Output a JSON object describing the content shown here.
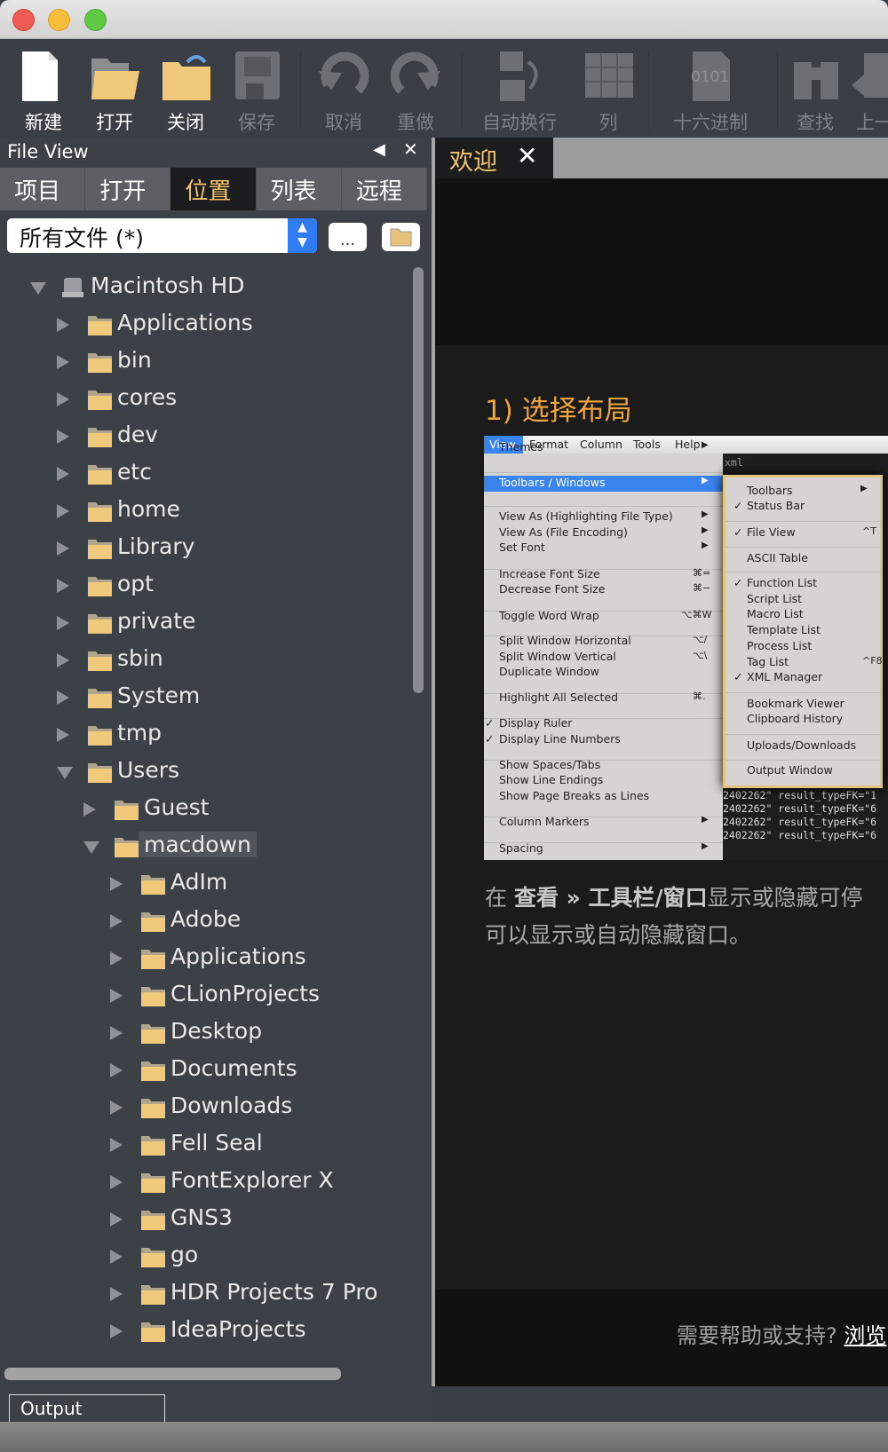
{
  "toolbar": {
    "items": [
      {
        "label": "新建",
        "icon": "new-file-icon",
        "enabled": true
      },
      {
        "label": "打开",
        "icon": "open-folder-icon",
        "enabled": true
      },
      {
        "label": "关闭",
        "icon": "close-folder-icon",
        "enabled": true
      },
      {
        "label": "保存",
        "icon": "save-icon",
        "enabled": false
      },
      {
        "label": "取消",
        "icon": "undo-icon",
        "enabled": false
      },
      {
        "label": "重做",
        "icon": "redo-icon",
        "enabled": false
      },
      {
        "label": "自动换行",
        "icon": "word-wrap-icon",
        "enabled": false
      },
      {
        "label": "列",
        "icon": "column-icon",
        "enabled": false
      },
      {
        "label": "十六进制",
        "icon": "hex-icon",
        "enabled": false,
        "glyph": "0101"
      },
      {
        "label": "查找",
        "icon": "find-binoculars-icon",
        "enabled": false
      },
      {
        "label": "上一",
        "icon": "previous-icon",
        "enabled": false
      }
    ]
  },
  "fileview": {
    "title": "File View",
    "tabs": [
      {
        "label": "项目"
      },
      {
        "label": "打开"
      },
      {
        "label": "位置",
        "active": true
      },
      {
        "label": "列表"
      },
      {
        "label": "远程"
      }
    ],
    "filter": "所有文件 (*)",
    "browse_label": "...",
    "tree": [
      {
        "name": "Macintosh HD",
        "depth": 0,
        "expanded": true,
        "icon": "disk"
      },
      {
        "name": "Applications",
        "depth": 1
      },
      {
        "name": "bin",
        "depth": 1
      },
      {
        "name": "cores",
        "depth": 1
      },
      {
        "name": "dev",
        "depth": 1
      },
      {
        "name": "etc",
        "depth": 1
      },
      {
        "name": "home",
        "depth": 1
      },
      {
        "name": "Library",
        "depth": 1
      },
      {
        "name": "opt",
        "depth": 1
      },
      {
        "name": "private",
        "depth": 1
      },
      {
        "name": "sbin",
        "depth": 1
      },
      {
        "name": "System",
        "depth": 1
      },
      {
        "name": "tmp",
        "depth": 1
      },
      {
        "name": "Users",
        "depth": 1,
        "expanded": true
      },
      {
        "name": "Guest",
        "depth": 2
      },
      {
        "name": "macdown",
        "depth": 2,
        "expanded": true,
        "selected": true
      },
      {
        "name": "AdIm",
        "depth": 3
      },
      {
        "name": "Adobe",
        "depth": 3
      },
      {
        "name": "Applications",
        "depth": 3
      },
      {
        "name": "CLionProjects",
        "depth": 3
      },
      {
        "name": "Desktop",
        "depth": 3
      },
      {
        "name": "Documents",
        "depth": 3
      },
      {
        "name": "Downloads",
        "depth": 3
      },
      {
        "name": "Fell Seal",
        "depth": 3
      },
      {
        "name": "FontExplorer X",
        "depth": 3
      },
      {
        "name": "GNS3",
        "depth": 3
      },
      {
        "name": "go",
        "depth": 3
      },
      {
        "name": "HDR Projects 7 Pro",
        "depth": 3
      },
      {
        "name": "IdeaProjects",
        "depth": 3
      }
    ]
  },
  "output_tab": "Output Window",
  "editor": {
    "tab": "欢迎",
    "tab_close": "✕",
    "heading": "1) 选择布局",
    "desc_line1_a": "在 ",
    "desc_line1_b": "查看 » 工具栏/窗口",
    "desc_line1_c": "显示或隐藏可停",
    "desc_line2": "可以显示或自动隐藏窗口。",
    "help_text": "需要帮助或支持?",
    "help_link": "浏览"
  },
  "screenshot": {
    "menubar": [
      "View",
      "Format",
      "Column",
      "Tools",
      "Help"
    ],
    "code_header": "xml",
    "code_lines": [
      "2402262\" result_typeFK=\"1",
      "2402262\" result_typeFK=\"6",
      "2402262\" result_typeFK=\"6",
      "2402262\" result_typeFK=\"6"
    ],
    "menu": [
      {
        "label": "Themes",
        "arrow": true
      },
      {
        "sep": true
      },
      {
        "label": "Toolbars / Windows",
        "arrow": true,
        "highlight": true
      },
      {
        "sep": true
      },
      {
        "label": "View As (Highlighting File Type)",
        "arrow": true
      },
      {
        "label": "View As (File Encoding)",
        "arrow": true
      },
      {
        "label": "Set Font",
        "arrow": true
      },
      {
        "sep": true
      },
      {
        "label": "Increase Font Size",
        "shortcut": "⌘="
      },
      {
        "label": "Decrease Font Size",
        "shortcut": "⌘−"
      },
      {
        "sep": true
      },
      {
        "label": "Toggle Word Wrap",
        "shortcut": "⌥⌘W"
      },
      {
        "sep": true
      },
      {
        "label": "Split Window Horizontal",
        "shortcut": "⌥/"
      },
      {
        "label": "Split Window Vertical",
        "shortcut": "⌥\\"
      },
      {
        "label": "Duplicate Window"
      },
      {
        "sep": true
      },
      {
        "label": "Highlight All Selected",
        "shortcut": "⌘."
      },
      {
        "sep": true
      },
      {
        "label": "Display Ruler",
        "checked": true
      },
      {
        "label": "Display Line Numbers",
        "checked": true
      },
      {
        "sep": true
      },
      {
        "label": "Show Spaces/Tabs"
      },
      {
        "label": "Show Line Endings"
      },
      {
        "label": "Show Page Breaks as Lines"
      },
      {
        "sep": true
      },
      {
        "label": "Column Markers",
        "arrow": true
      },
      {
        "sep": true
      },
      {
        "label": "Spacing",
        "arrow": true
      }
    ],
    "submenu": [
      {
        "label": "Toolbars",
        "arrow": true
      },
      {
        "label": "Status Bar",
        "checked": true
      },
      {
        "sep": true
      },
      {
        "label": "File View",
        "checked": true,
        "shortcut": "^T"
      },
      {
        "sep": true
      },
      {
        "label": "ASCII Table"
      },
      {
        "sep": true
      },
      {
        "label": "Function List",
        "checked": true
      },
      {
        "label": "Script List"
      },
      {
        "label": "Macro List"
      },
      {
        "label": "Template List"
      },
      {
        "label": "Process List"
      },
      {
        "label": "Tag List",
        "shortcut": "^F8"
      },
      {
        "label": "XML Manager",
        "checked": true
      },
      {
        "sep": true
      },
      {
        "label": "Bookmark Viewer"
      },
      {
        "label": "Clipboard History"
      },
      {
        "sep": true
      },
      {
        "label": "Uploads/Downloads"
      },
      {
        "sep": true
      },
      {
        "label": "Output Window"
      }
    ]
  },
  "colors": {
    "accent": "#f3c46e",
    "heading": "#f0a53a",
    "highlight": "#3a84f0",
    "folder": "#f0c97a"
  }
}
